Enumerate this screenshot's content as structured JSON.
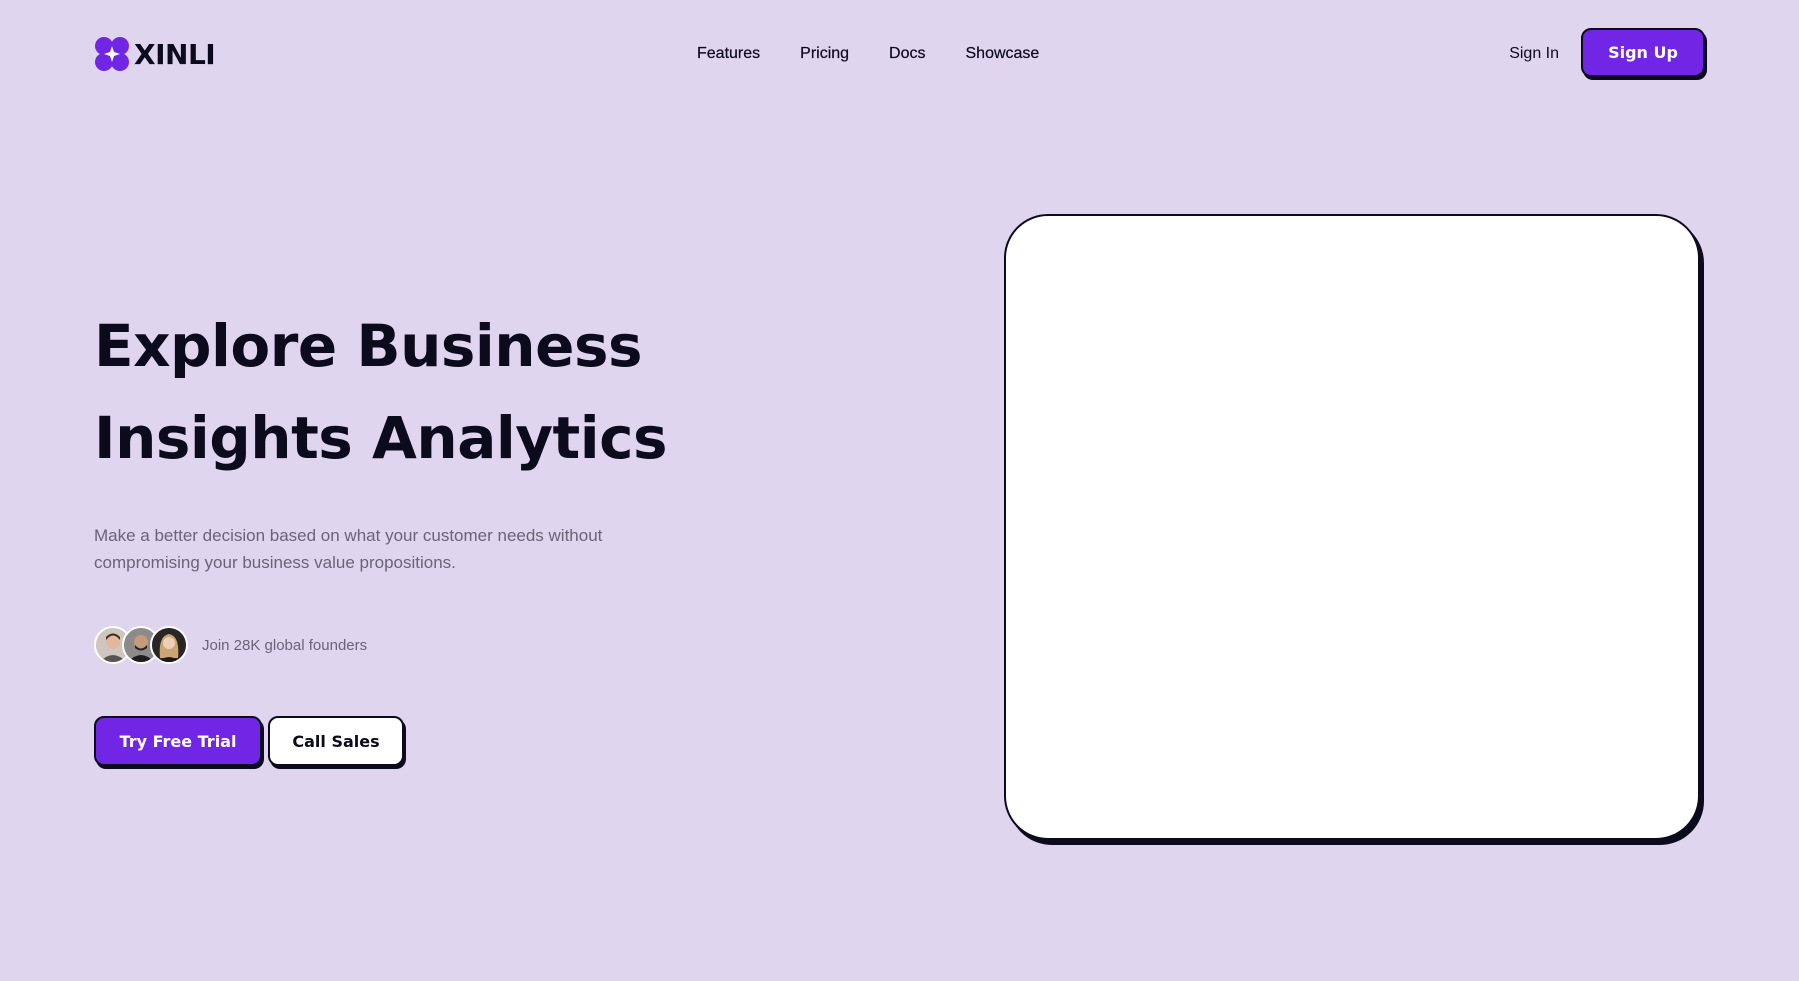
{
  "colors": {
    "background": "#e0d5ee",
    "accent": "#7126e6",
    "text": "#0c0a1d",
    "muted": "#6a6478"
  },
  "header": {
    "logo_icon": "flower-sparkle-icon",
    "logo_text": "XINLI",
    "nav": [
      {
        "label": "Features"
      },
      {
        "label": "Pricing"
      },
      {
        "label": "Docs"
      },
      {
        "label": "Showcase"
      }
    ],
    "sign_in": "Sign In",
    "sign_up": "Sign Up"
  },
  "hero": {
    "headline_line1": "Explore Business",
    "headline_line2": "Insights Analytics",
    "subtext": "Make a better decision based on what your customer needs without compromising your business value propositions.",
    "social_proof": "Join 28K global founders",
    "primary_cta": "Try Free Trial",
    "secondary_cta": "Call Sales"
  }
}
